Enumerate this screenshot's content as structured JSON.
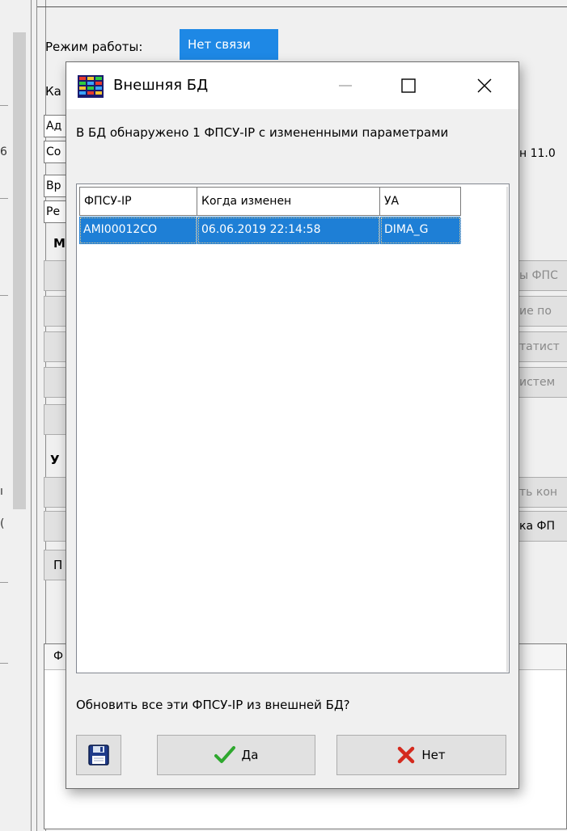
{
  "background": {
    "mode_label": "Режим работы:",
    "mode_status": "Нет связи",
    "mode_status_color": "#1e88e5",
    "left_fragments": [
      "6",
      "(",
      "ı"
    ],
    "fragments": {
      "ka": "Ка",
      "ad": "Ад",
      "co": "Со",
      "vr": "Вр",
      "re": "Ре",
      "m": "М",
      "u": "У",
      "r": "Р",
      "y": "У",
      "p": "П",
      "f": "Ф"
    },
    "right_fragments": {
      "version": "н 11.0",
      "btn1": "ы ФПС",
      "btn2": "ие по",
      "btn3": "татист",
      "btn4": "истем",
      "btn5": "ть кон",
      "btn6": "ка ФП"
    }
  },
  "dialog": {
    "title": "Внешняя БД",
    "title_icon": "database-grid-icon",
    "controls": {
      "minimize_icon": "minimize-icon",
      "maximize_icon": "maximize-icon",
      "close_icon": "close-icon"
    },
    "message": "В БД обнаружено 1 ФПСУ-IP с измененными параметрами",
    "table": {
      "columns": [
        "ФПСУ-IP",
        "Когда изменен",
        "УА"
      ],
      "rows": [
        [
          "AMI00012CO",
          "06.06.2019 22:14:58",
          "DIMA_G"
        ]
      ],
      "selection_color": "#1e7fd6"
    },
    "question": "Обновить все эти  ФПСУ-IP из внешней БД?",
    "buttons": {
      "save_icon": "floppy-disk-icon",
      "yes_label": "Да",
      "yes_icon": "checkmark-icon",
      "no_label": "Нет",
      "no_icon": "red-x-icon"
    }
  }
}
